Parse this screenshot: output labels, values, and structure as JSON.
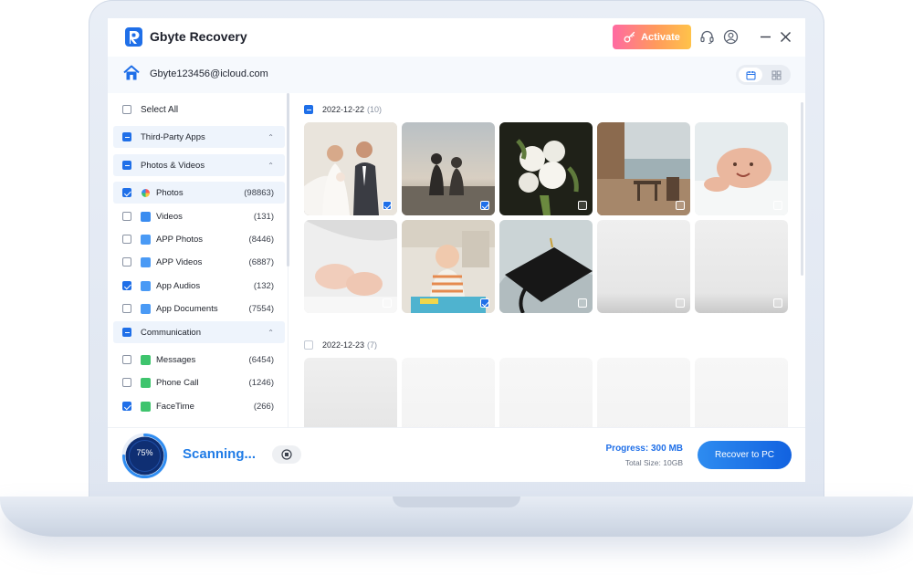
{
  "app": {
    "title": "Gbyte Recovery",
    "activate_label": "Activate",
    "icons": [
      "support-headset-icon",
      "user-account-icon",
      "minimize-icon",
      "close-icon"
    ]
  },
  "account": {
    "email": "Gbyte123456@icloud.com"
  },
  "sidebar": {
    "select_all_label": "Select All",
    "groups": [
      {
        "label": "Third-Party Apps",
        "state": "partial",
        "chevron": "⌃"
      },
      {
        "label": "Photos & Videos",
        "state": "partial",
        "chevron": "⌃"
      },
      {
        "label": "Communication",
        "state": "partial",
        "chevron": "⌃"
      }
    ],
    "items": [
      {
        "label": "Photos",
        "count": "(98863)",
        "checked": true,
        "icon": "photos-icon"
      },
      {
        "label": "Videos",
        "count": "(131)",
        "checked": false,
        "icon": "videos-icon"
      },
      {
        "label": "APP Photos",
        "count": "(8446)",
        "checked": false,
        "icon": "app-photos-icon"
      },
      {
        "label": "APP Videos",
        "count": "(6887)",
        "checked": false,
        "icon": "app-videos-icon"
      },
      {
        "label": "App Audios",
        "count": "(132)",
        "checked": true,
        "icon": "app-audios-icon"
      },
      {
        "label": "App Documents",
        "count": "(7554)",
        "checked": false,
        "icon": "app-documents-icon"
      },
      {
        "label": "Messages",
        "count": "(6454)",
        "checked": false,
        "icon": "messages-icon"
      },
      {
        "label": "Phone Call",
        "count": "(1246)",
        "checked": false,
        "icon": "phone-call-icon"
      },
      {
        "label": "FaceTime",
        "count": "(266)",
        "checked": true,
        "icon": "facetime-icon"
      }
    ]
  },
  "main": {
    "date_groups": [
      {
        "date": "2022-12-22",
        "count": "(10)",
        "state": "partial"
      },
      {
        "date": "2022-12-23",
        "count": "(7)",
        "state": "unchecked"
      }
    ],
    "photos": [
      {
        "subject": "wedding couple",
        "checked": true
      },
      {
        "subject": "couple silhouette at sunset",
        "checked": true
      },
      {
        "subject": "white rose bouquet",
        "checked": false
      },
      {
        "subject": "terrace by the sea",
        "checked": false
      },
      {
        "subject": "smiling baby",
        "checked": false
      },
      {
        "subject": "baby feet",
        "checked": false
      },
      {
        "subject": "toddler in kitchen",
        "checked": true
      },
      {
        "subject": "graduation cap",
        "checked": false
      }
    ]
  },
  "footer": {
    "progress_percent": "75%",
    "progress_value": 0.75,
    "status": "Scanning...",
    "progress_label": "Progress: 300 MB",
    "total_size_label": "Total Size: 10GB",
    "recover_label": "Recover to PC"
  },
  "colors": {
    "accent": "#1f6fe8",
    "activate_gradient": [
      "#ff6aa2",
      "#ffc34a"
    ]
  }
}
